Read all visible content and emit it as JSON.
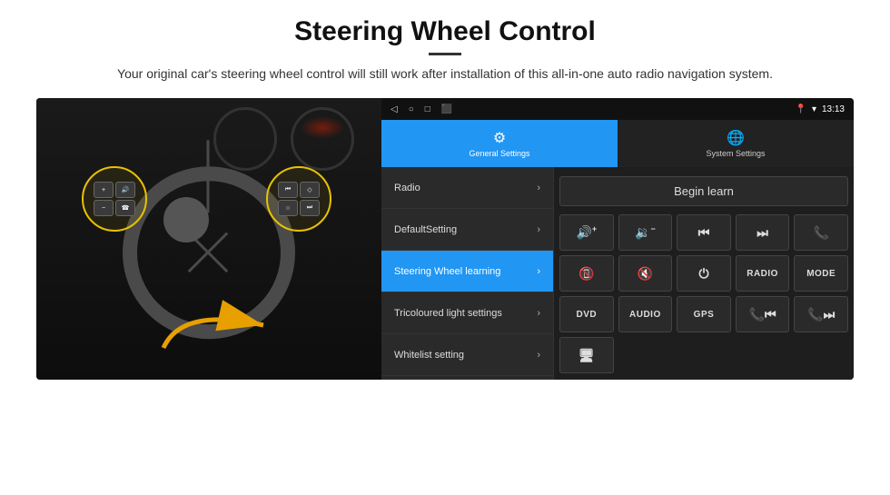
{
  "header": {
    "title": "Steering Wheel Control",
    "subtitle": "Your original car's steering wheel control will still work after installation of this all-in-one auto radio navigation system."
  },
  "status_bar": {
    "time": "13:13",
    "icons": [
      "◁",
      "○",
      "□",
      "⬛"
    ]
  },
  "tabs": [
    {
      "id": "general",
      "label": "General Settings",
      "active": true
    },
    {
      "id": "system",
      "label": "System Settings",
      "active": false
    }
  ],
  "menu": {
    "items": [
      {
        "id": "radio",
        "label": "Radio",
        "active": false
      },
      {
        "id": "default",
        "label": "DefaultSetting",
        "active": false
      },
      {
        "id": "steering",
        "label": "Steering Wheel learning",
        "active": true
      },
      {
        "id": "tricolour",
        "label": "Tricoloured light settings",
        "active": false
      },
      {
        "id": "whitelist",
        "label": "Whitelist setting",
        "active": false
      }
    ]
  },
  "controls": {
    "begin_learn": "Begin learn",
    "row1": [
      {
        "id": "vol_up",
        "icon": "🔊+",
        "type": "icon"
      },
      {
        "id": "vol_down",
        "icon": "🔉-",
        "type": "icon"
      },
      {
        "id": "prev_track",
        "icon": "⏮",
        "type": "icon"
      },
      {
        "id": "next_track",
        "icon": "⏭",
        "type": "icon"
      },
      {
        "id": "phone",
        "icon": "📞",
        "type": "icon"
      }
    ],
    "row2": [
      {
        "id": "call_end",
        "icon": "📵",
        "type": "icon"
      },
      {
        "id": "mute",
        "icon": "🔇",
        "type": "icon"
      },
      {
        "id": "power",
        "icon": "⏻",
        "type": "icon"
      },
      {
        "id": "radio_btn",
        "label": "RADIO",
        "type": "text"
      },
      {
        "id": "mode_btn",
        "label": "MODE",
        "type": "text"
      }
    ],
    "row3": [
      {
        "id": "dvd_btn",
        "label": "DVD",
        "type": "text"
      },
      {
        "id": "audio_btn",
        "label": "AUDIO",
        "type": "text"
      },
      {
        "id": "gps_btn",
        "label": "GPS",
        "type": "text"
      },
      {
        "id": "tel_prev",
        "icon": "📞⏮",
        "type": "icon"
      },
      {
        "id": "tel_next",
        "icon": "📞⏭",
        "type": "icon"
      }
    ],
    "row4": [
      {
        "id": "info_btn",
        "icon": "🖥",
        "type": "icon"
      }
    ]
  }
}
